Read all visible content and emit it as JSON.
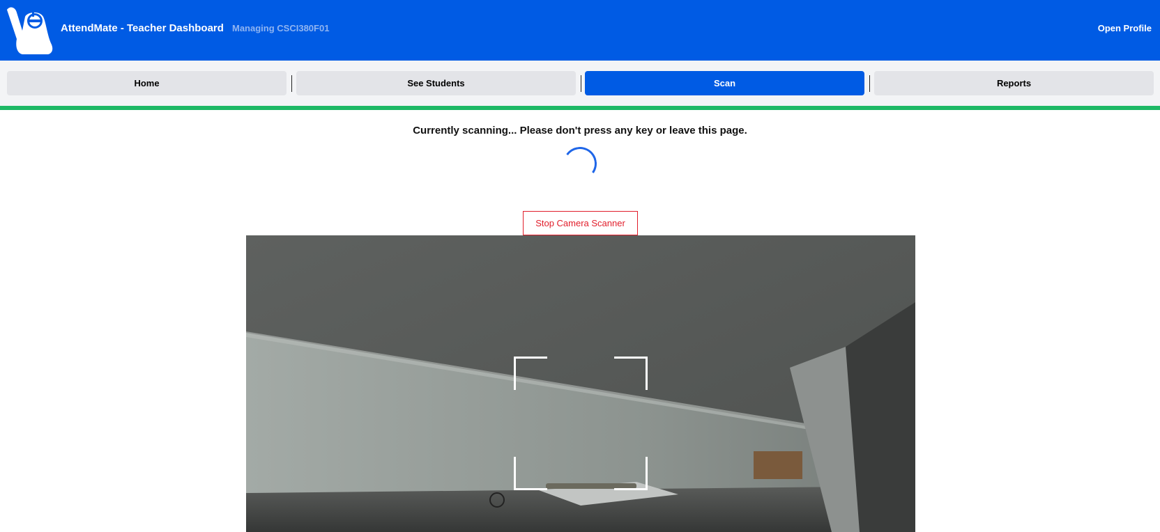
{
  "header": {
    "app_title": "AttendMate - Teacher Dashboard",
    "managing_text": "Managing CSCI380F01",
    "profile_link": "Open Profile",
    "logo_icon": "hand-logo-icon"
  },
  "nav": {
    "tabs": [
      {
        "label": "Home",
        "active": false
      },
      {
        "label": "See Students",
        "active": false
      },
      {
        "label": "Scan",
        "active": true
      },
      {
        "label": "Reports",
        "active": false
      }
    ],
    "progress_fraction": 1.0
  },
  "scan": {
    "status_message": "Currently scanning... Please don't press any key or leave this page.",
    "stop_button_label": "Stop Camera Scanner"
  },
  "colors": {
    "header_bg": "#005be4",
    "tab_active_bg": "#005be4",
    "tab_bg": "#e3e4e8",
    "progress_green": "#1db865",
    "stop_red": "#e11d2a"
  }
}
